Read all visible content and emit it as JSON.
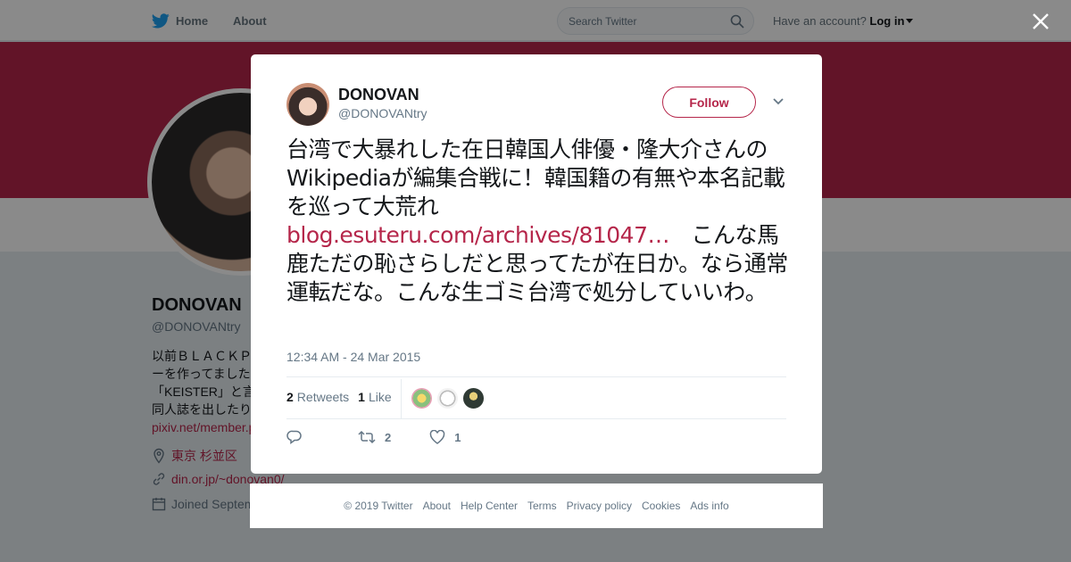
{
  "topbar": {
    "home_label": "Home",
    "about_label": "About",
    "search_placeholder": "Search Twitter",
    "account_prompt": "Have an account?",
    "login_label": "Log in"
  },
  "profile": {
    "name": "DONOVAN",
    "handle": "@DONOVANtry",
    "bio_lines": [
      "以前ＢＬＡＣＫＰ",
      "ーを作ってました",
      "「KEISTER」と言",
      "同人誌を出したり"
    ],
    "bio_link": "pixiv.net/member.p",
    "location": "東京 杉並区",
    "website": "din.or.jp/~donovan0/",
    "joined": "Joined Septem"
  },
  "tweet": {
    "author_name": "DONOVAN",
    "author_handle": "@DONOVANtry",
    "follow_label": "Follow",
    "text_part1": "台湾で大暴れした在日韓国人俳優・隆大介さんのWikipediaが編集合戦に！韓国籍の有無や本名記載を巡って大荒れ",
    "link": " blog.esuteru.com/archives/81047…",
    "text_part2": "　こんな馬鹿ただの恥さらしだと思ってたが在日か。なら通常運転だな。こんな生ゴミ台湾で処分していいわ。",
    "timestamp": "12:34 AM - 24 Mar 2015",
    "retweets_count": "2",
    "retweets_label": "Retweets",
    "likes_count": "1",
    "likes_label": "Like",
    "action_retweet_count": "2",
    "action_like_count": "1"
  },
  "footer": {
    "copyright": "© 2019 Twitter",
    "about": "About",
    "help": "Help Center",
    "terms": "Terms",
    "privacy": "Privacy policy",
    "cookies": "Cookies",
    "ads": "Ads info"
  },
  "colors": {
    "accent": "#b5264a",
    "twitter_blue": "#1da1f2"
  }
}
